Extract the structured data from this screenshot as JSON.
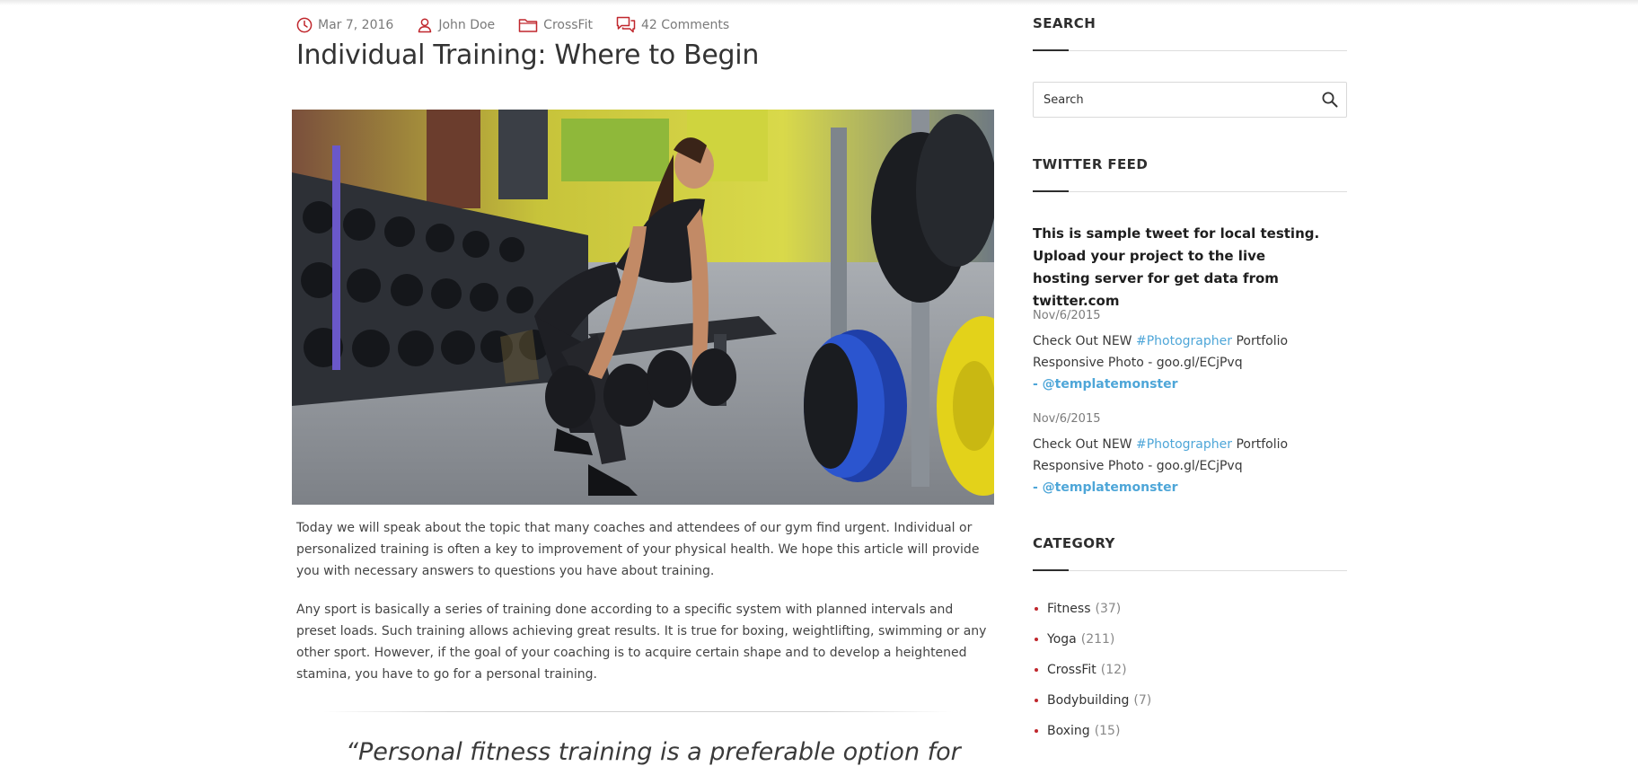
{
  "post": {
    "meta": {
      "date": "Mar 7, 2016",
      "author": "John Doe",
      "category": "CrossFit",
      "comments": "42 Comments"
    },
    "title": "Individual Training: Where to Begin",
    "paragraphs": [
      "Today we will speak about the topic that many coaches and attendees of our gym find urgent. Individual or personalized training is often a key to improvement of your physical health. We hope this article will provide you with necessary answers to questions you have about training.",
      "Any sport is basically a series of training done according to a specific system with planned intervals and preset loads. Such training allows achieving great results. It is true for boxing, weightlifting, swimming or any other sport. However, if the goal of your coaching is to acquire certain shape and to develop a heightened stamina, you have to go for a personal training."
    ],
    "quote": "“Personal fitness training is a preferable option for"
  },
  "sidebar": {
    "search": {
      "title": "SEARCH",
      "placeholder": "Search"
    },
    "twitter": {
      "title": "TWITTER FEED",
      "featured": "This is sample tweet for local testing. Upload your project to the live hosting server for get data from twitter.com",
      "tweets": [
        {
          "date": "Nov/6/2015",
          "before": "Check Out NEW ",
          "hashtag": "#Photographer",
          "after": " Portfolio Responsive Photo - goo.gl/ECjPvq",
          "handle": "- @templatemonster"
        },
        {
          "date": "Nov/6/2015",
          "before": "Check Out NEW ",
          "hashtag": "#Photographer",
          "after": " Portfolio Responsive Photo - goo.gl/ECjPvq",
          "handle": "- @templatemonster"
        }
      ]
    },
    "category": {
      "title": "CATEGORY",
      "items": [
        {
          "name": "Fitness",
          "count": "(37)"
        },
        {
          "name": "Yoga",
          "count": "(211)"
        },
        {
          "name": "CrossFit",
          "count": "(12)"
        },
        {
          "name": "Bodybuilding",
          "count": "(7)"
        },
        {
          "name": "Boxing",
          "count": "(15)"
        }
      ]
    }
  },
  "icons": {
    "date": "clock-icon",
    "author": "user-icon",
    "category": "folder-icon",
    "comments": "comments-icon",
    "search": "search-icon"
  },
  "colors": {
    "accent": "#c0272d",
    "link": "#4ea6d8",
    "text": "#444444",
    "muted": "#7a7a7a"
  }
}
